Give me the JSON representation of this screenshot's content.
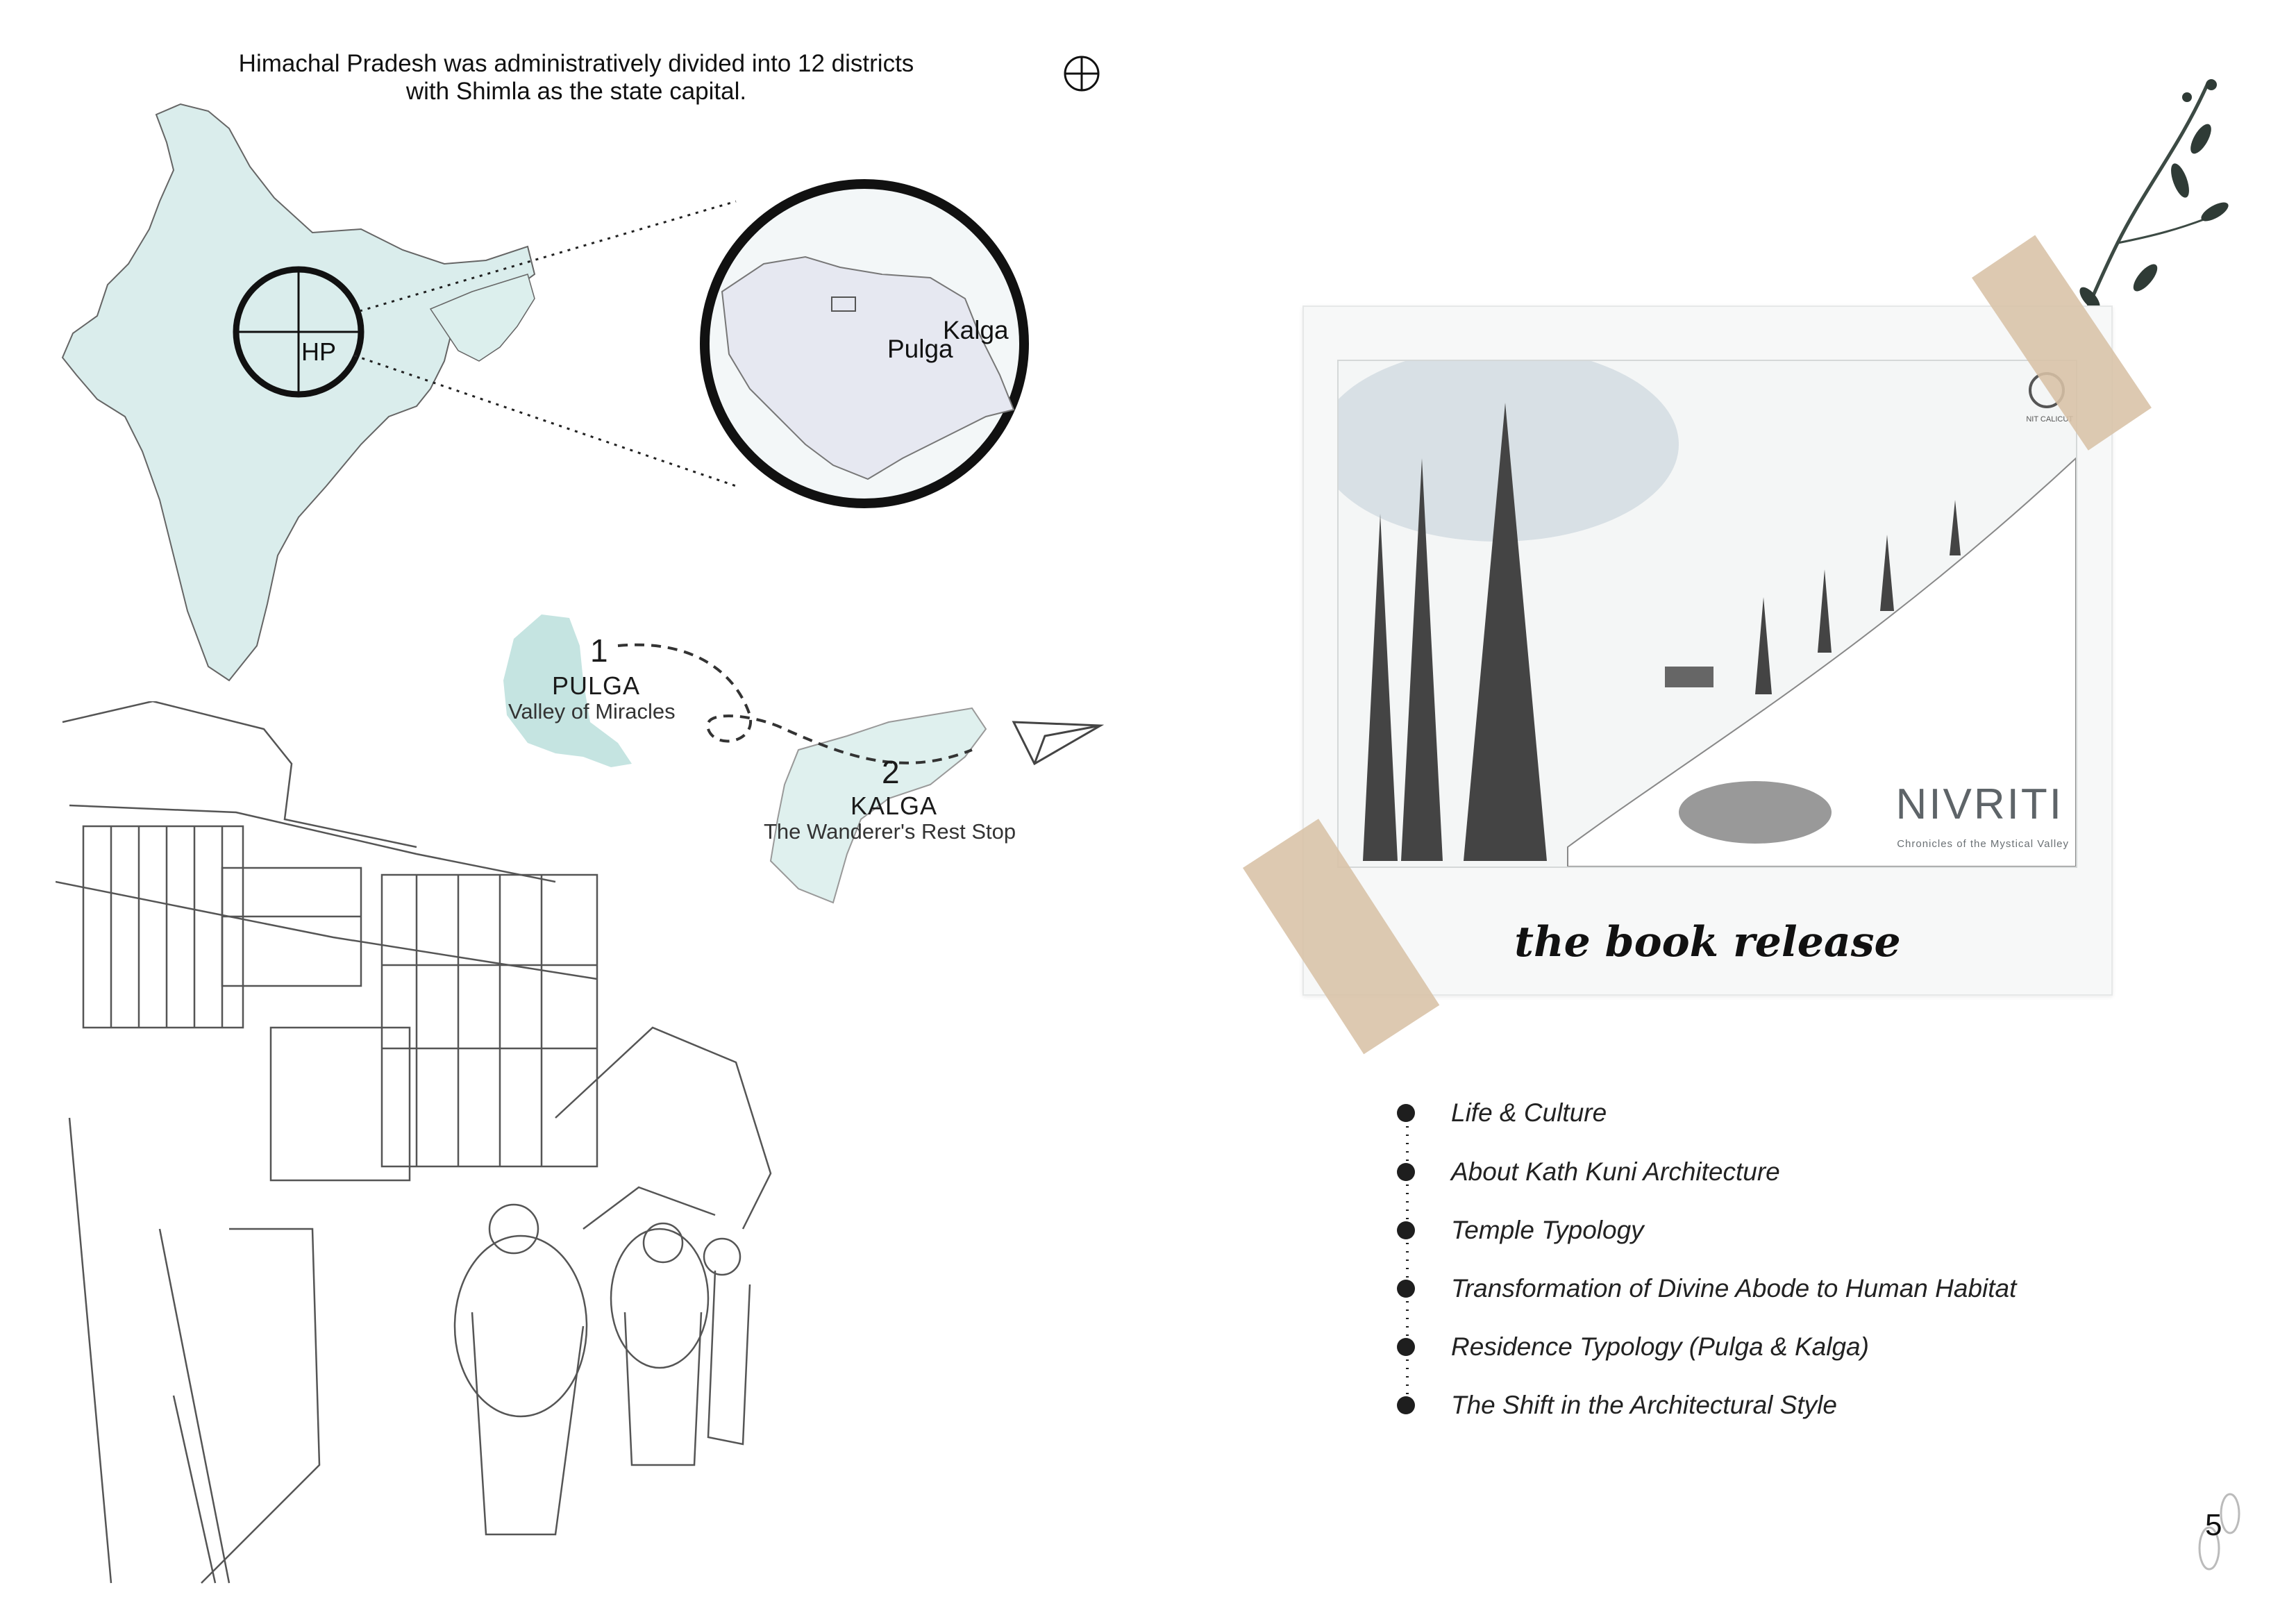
{
  "intro": {
    "line1": "Himachal Pradesh was administratively divided into 12 districts",
    "line2": "with Shimla as the state capital."
  },
  "map": {
    "hp_label": "HP",
    "inset_labels": [
      "Pulga",
      "Kalga"
    ]
  },
  "route": {
    "stops": [
      {
        "number": "1",
        "name": "PULGA",
        "tagline": "Valley of Miracles"
      },
      {
        "number": "2",
        "name": "KALGA",
        "tagline": "The Wanderer's Rest Stop"
      }
    ]
  },
  "book": {
    "title": "NIVRITI",
    "subtitle": "Chronicles of the Mystical Valley",
    "logo_text": "NIT CALICUT",
    "caption": "the book release"
  },
  "contents": [
    "Life & Culture",
    "About Kath Kuni Architecture",
    "Temple Typology",
    "Transformation of Divine Abode to Human Habitat",
    "Residence Typology (Pulga & Kalga)",
    "The Shift in the Architectural Style"
  ],
  "page_number": "5",
  "colors": {
    "map_tint": "#d6ecea",
    "region_tint": "#bfe1de",
    "tape": "#d8c2a6",
    "ink": "#1a1a1a"
  },
  "icons": [
    "compass-icon",
    "paper-plane-icon",
    "footprint-icon",
    "twig-icon",
    "tape-icon"
  ]
}
